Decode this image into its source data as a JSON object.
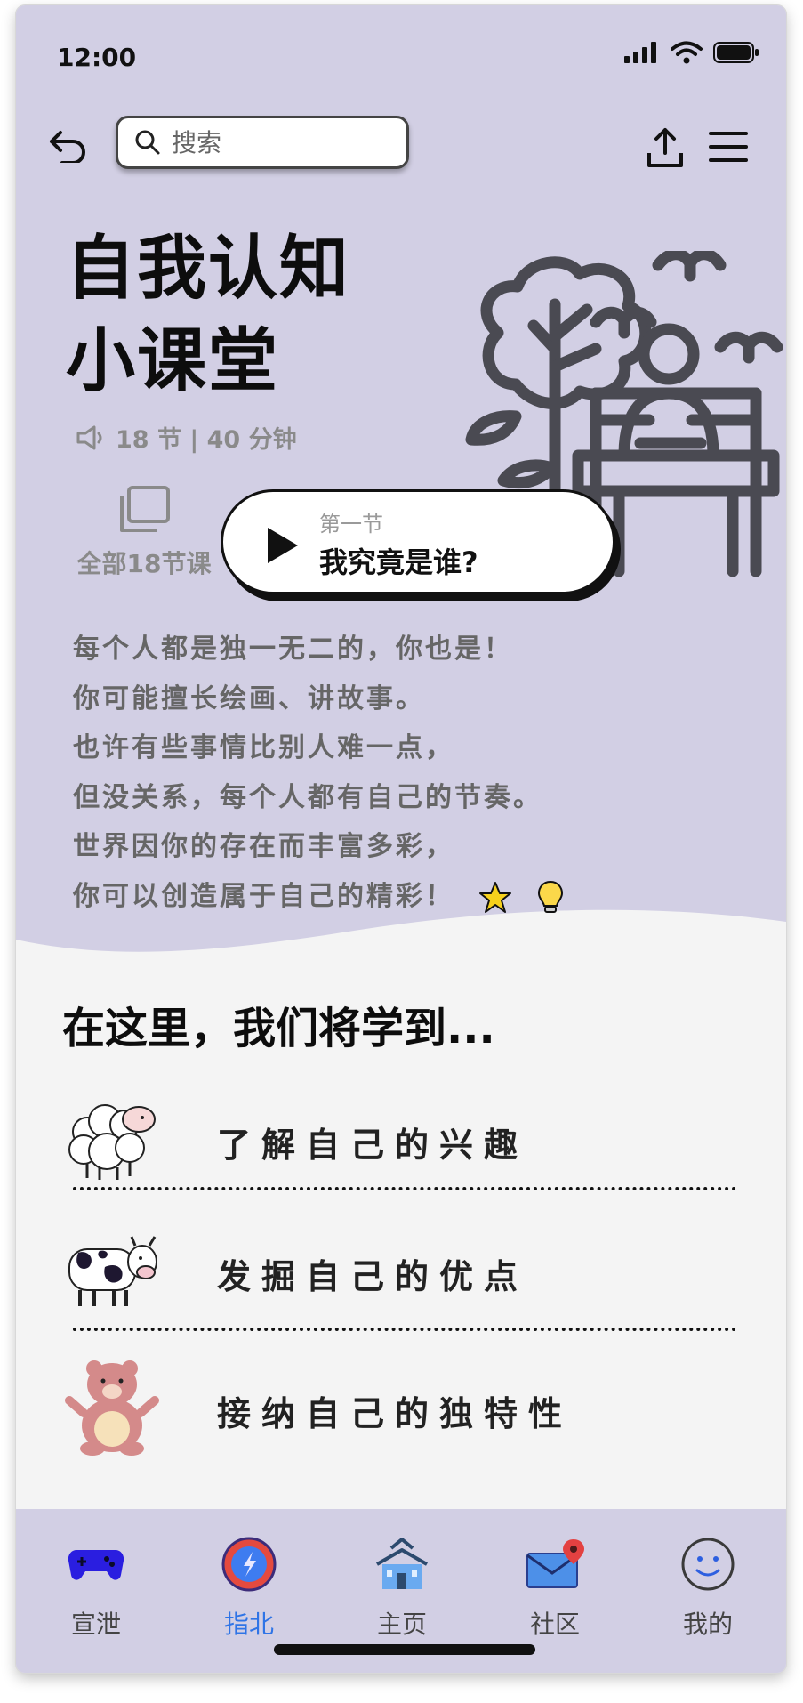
{
  "status_bar": {
    "time": "12:00"
  },
  "search": {
    "placeholder": "搜索"
  },
  "hero": {
    "title_line1": "自我认知",
    "title_line2": "小课堂",
    "meta": "18 节 | 40 分钟",
    "all_lessons_label": "全部18节课",
    "current_lesson": {
      "label": "第一节",
      "title": "我究竟是谁?"
    },
    "poem": [
      "每个人都是独一无二的，你也是！",
      "你可能擅长绘画、讲故事。",
      "也许有些事情比别人难一点，",
      "但没关系，每个人都有自己的节奏。",
      "世界因你的存在而丰富多彩，",
      "你可以创造属于自己的精彩！"
    ]
  },
  "learn": {
    "heading": "在这里，我们将学到...",
    "items": [
      {
        "label": "了解自己的兴趣",
        "icon": "sheep-icon"
      },
      {
        "label": "发掘自己的优点",
        "icon": "cow-icon"
      },
      {
        "label": "接纳自己的独特性",
        "icon": "bear-icon"
      }
    ]
  },
  "nav": {
    "items": [
      {
        "label": "宣泄",
        "icon": "gamepad-icon"
      },
      {
        "label": "指北",
        "icon": "compass-icon",
        "active": true
      },
      {
        "label": "主页",
        "icon": "school-icon"
      },
      {
        "label": "社区",
        "icon": "mail-icon"
      },
      {
        "label": "我的",
        "icon": "smiley-icon"
      }
    ]
  },
  "colors": {
    "hero_bg": "#d2cfe4",
    "body_bg": "#f4f4f4",
    "active_nav": "#2f74e6",
    "illustration": "#4a4a52"
  }
}
